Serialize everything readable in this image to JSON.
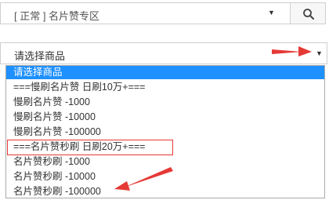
{
  "category_select": {
    "value": "[ 正常 ] 名片赞专区",
    "arrow": "▼"
  },
  "search_button": {
    "icon": "search-icon"
  },
  "product_select": {
    "value": "请选择商品",
    "arrow": "▼"
  },
  "dropdown": {
    "options": [
      "请选择商品",
      "===慢刷名片赞 日刷10万+===",
      "慢刷名片赞 -1000",
      "慢刷名片赞 -10000",
      "慢刷名片赞 -100000",
      "===名片赞秒刷 日刷20万+===",
      "名片赞秒刷 -1000",
      "名片赞秒刷 -10000",
      "名片赞秒刷 -100000"
    ],
    "selected_index": 0,
    "highlighted_index": 5
  },
  "colors": {
    "selected_bg": "#1e90ff",
    "annotation": "#e53935"
  }
}
